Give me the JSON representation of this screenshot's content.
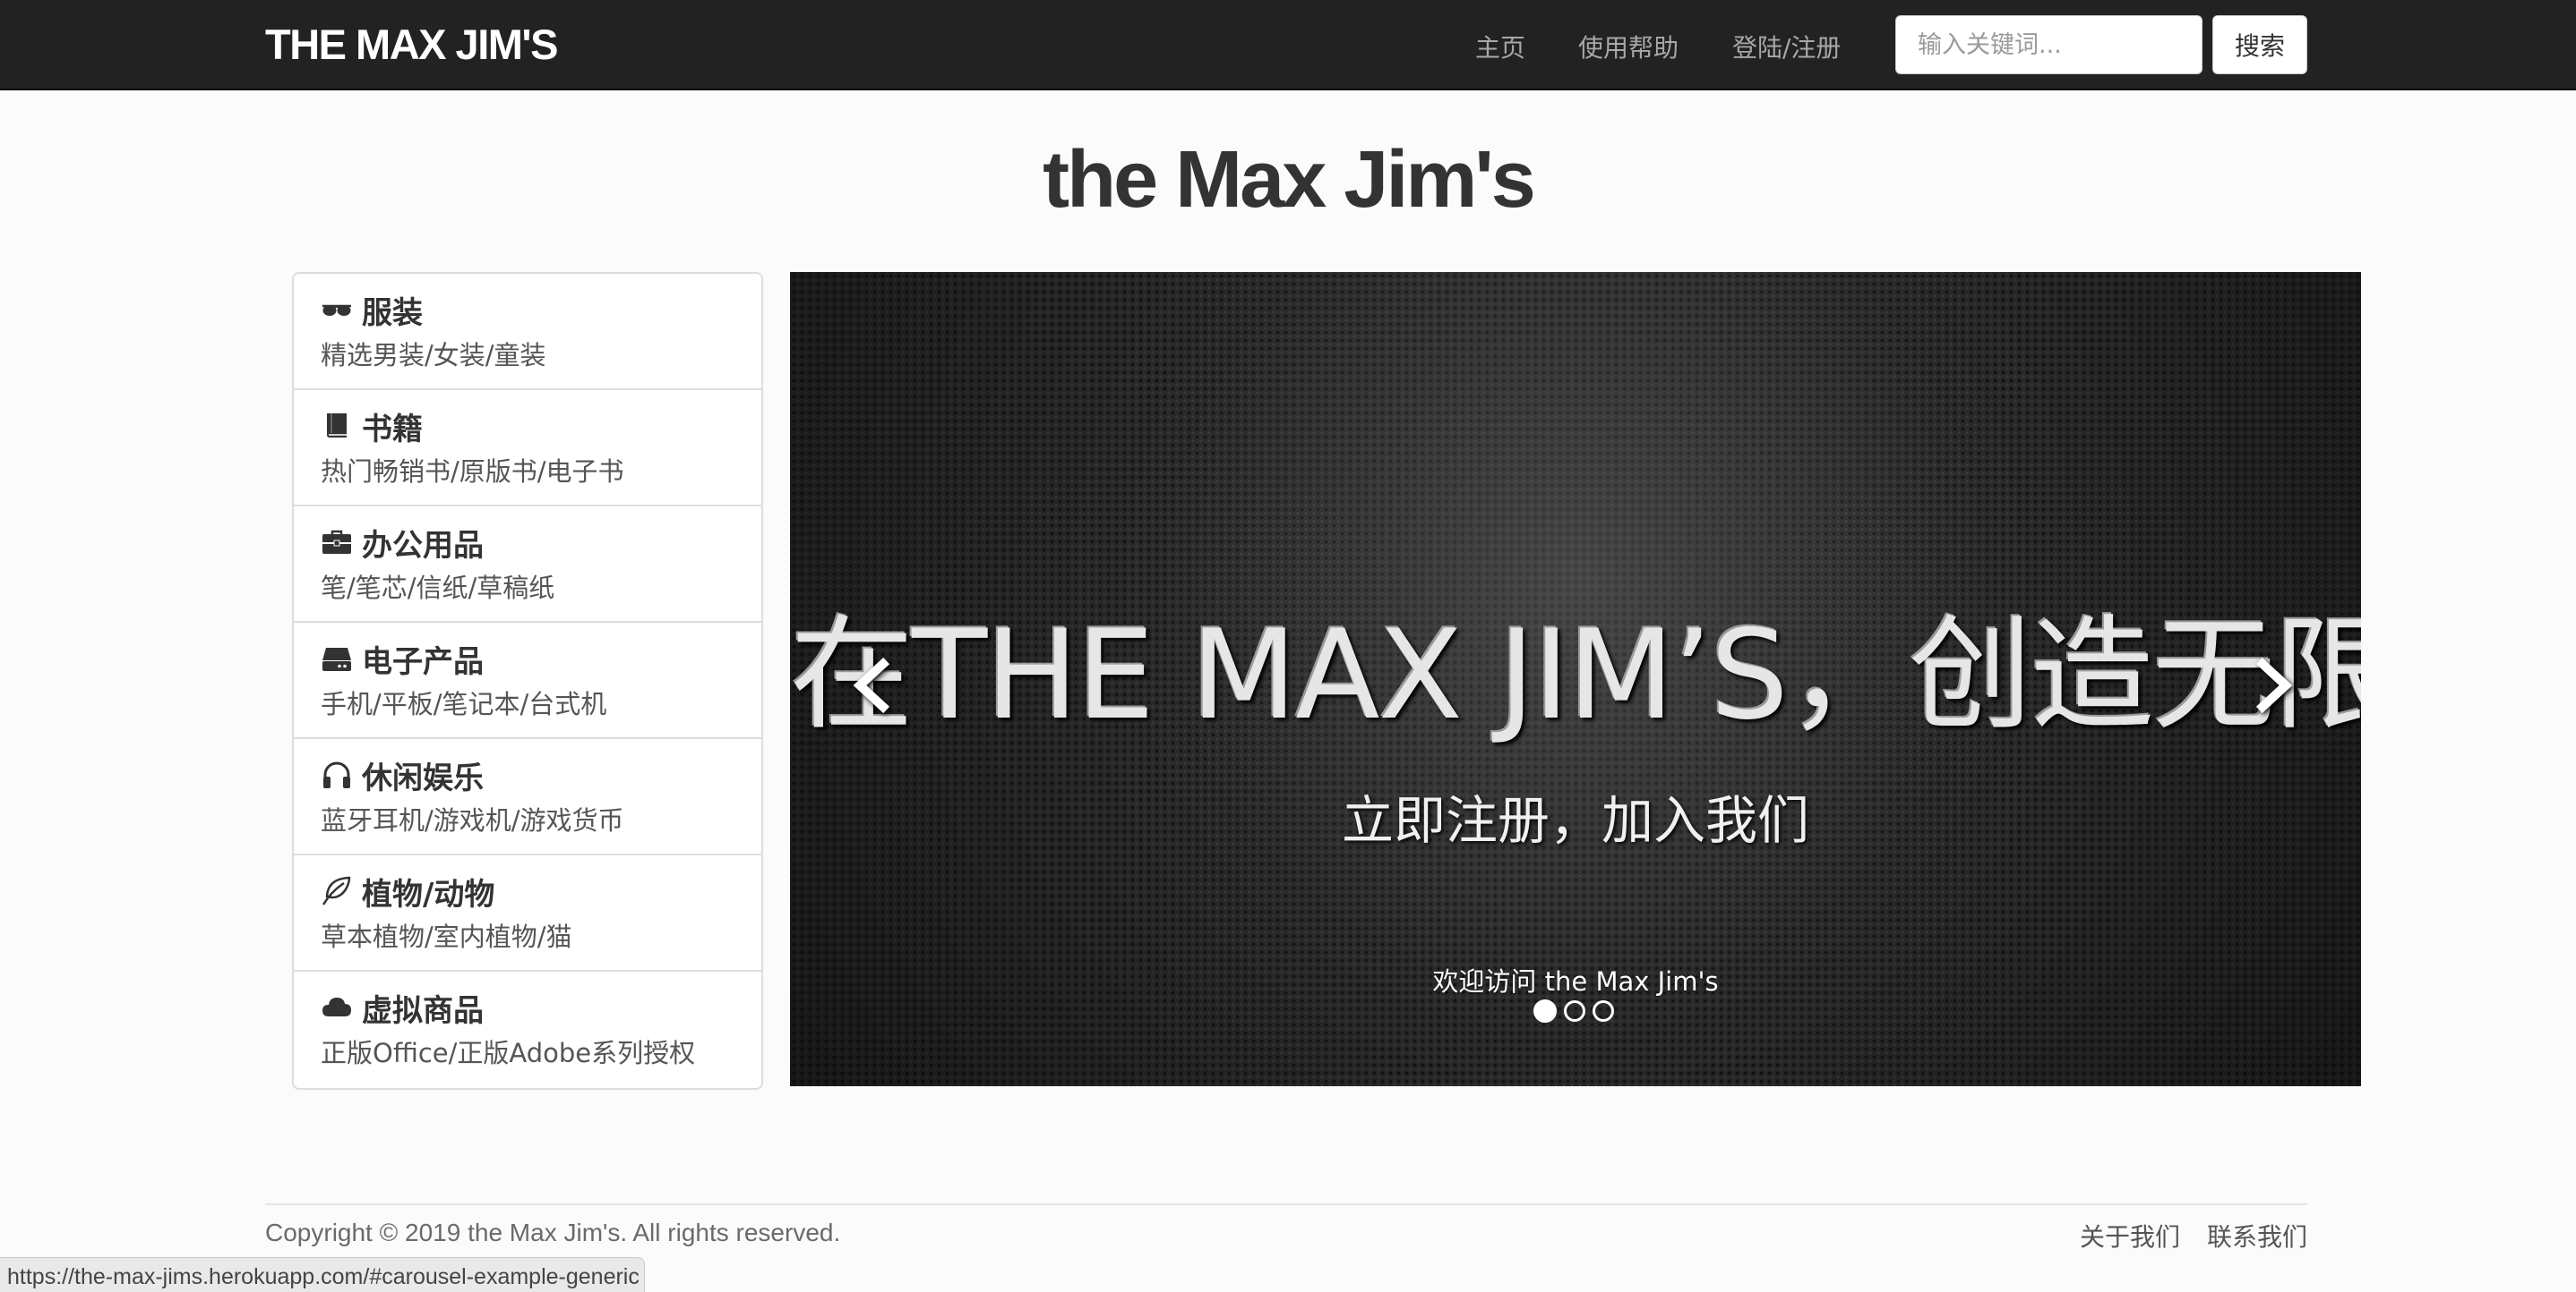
{
  "navbar": {
    "brand": "THE MAX JIM'S",
    "links": [
      "主页",
      "使用帮助",
      "登陆/注册"
    ],
    "search_placeholder": "输入关键词...",
    "search_button": "搜索"
  },
  "page_title": "the Max Jim's",
  "categories": [
    {
      "title": "服装",
      "subtitle": "精选男装/女装/童装",
      "icon": "sunglasses-icon"
    },
    {
      "title": "书籍",
      "subtitle": "热门畅销书/原版书/电子书",
      "icon": "book-icon"
    },
    {
      "title": "办公用品",
      "subtitle": "笔/笔芯/信纸/草稿纸",
      "icon": "briefcase-icon"
    },
    {
      "title": "电子产品",
      "subtitle": "手机/平板/笔记本/台式机",
      "icon": "hard-drive-icon"
    },
    {
      "title": "休闲娱乐",
      "subtitle": "蓝牙耳机/游戏机/游戏货币",
      "icon": "headphones-icon"
    },
    {
      "title": "植物/动物",
      "subtitle": "草本植物/室内植物/猫",
      "icon": "leaf-icon"
    },
    {
      "title": "虚拟商品",
      "subtitle": "正版Office/正版Adobe系列授权",
      "icon": "cloud-icon"
    }
  ],
  "carousel": {
    "headline": "在THE MAX JIM’S，创造无限可能",
    "subline": "立即注册，加入我们",
    "caption": "欢迎访问 the Max Jim's",
    "slide_count": 3,
    "active_index": 0
  },
  "footer": {
    "copyright": "Copyright © 2019 the Max Jim's. All rights reserved.",
    "links": [
      "关于我们",
      "联系我们"
    ]
  },
  "status_bar_url": "https://the-max-jims.herokuapp.com/#carousel-example-generic"
}
